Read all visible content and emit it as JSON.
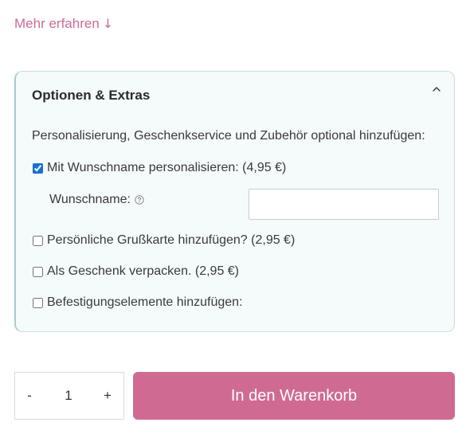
{
  "more_link": {
    "label": "Mehr erfahren",
    "arrow": "↓"
  },
  "options": {
    "title": "Optionen & Extras",
    "expanded": true,
    "intro": "Personalisierung, Geschenkservice und Zubehör optional hinzufügen:",
    "items": [
      {
        "label": "Mit Wunschname personalisieren: (4,95 €)",
        "checked": true
      },
      {
        "label": "Persönliche Grußkarte hinzufügen? (2,95 €)",
        "checked": false
      },
      {
        "label": "Als Geschenk verpacken. (2,95 €)",
        "checked": false
      },
      {
        "label": "Befestigungselemente hinzufügen:",
        "checked": false
      }
    ],
    "wunschname": {
      "label": "Wunschname:",
      "value": "",
      "placeholder": ""
    }
  },
  "quantity": {
    "minus": "-",
    "value": "1",
    "plus": "+"
  },
  "cart_button": {
    "label": "In den Warenkorb"
  },
  "colors": {
    "accent": "#cf6b93",
    "panel_bg": "#f5fafb",
    "panel_border": "#c7dde4",
    "checkbox": "#1a6fd1"
  },
  "icons": {
    "collapse": "chevron-up-icon",
    "help": "help-circle-icon",
    "more_arrow": "arrow-down-icon"
  }
}
